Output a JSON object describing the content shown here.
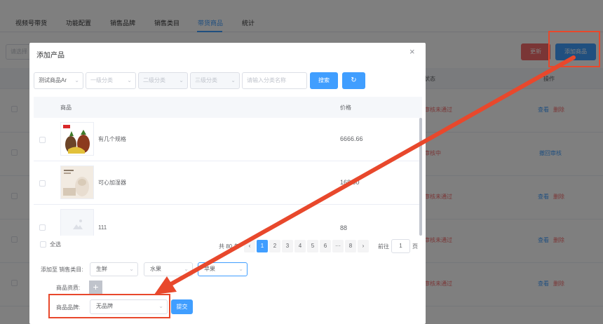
{
  "tabs": [
    "视频号带货",
    "功能配置",
    "销售品牌",
    "销售类目",
    "带货商品",
    "统计"
  ],
  "active_tab": "带货商品",
  "background": {
    "select_placeholder": "请选择",
    "refresh_label": "更新",
    "add_label": "添加商品",
    "col_status": "状态",
    "col_actions": "操作",
    "rows": [
      {
        "status": "审核未通过",
        "actions": [
          "查看",
          "删除"
        ]
      },
      {
        "status": "审核中",
        "actions": [
          "撤回审核"
        ]
      },
      {
        "status": "审核未通过",
        "actions": [
          "查看",
          "删除"
        ]
      },
      {
        "status": "审核未通过",
        "actions": [
          "查看",
          "删除"
        ]
      },
      {
        "status": "审核未通过",
        "actions": [
          "查看",
          "删除"
        ]
      }
    ]
  },
  "dialog": {
    "title": "添加产品",
    "close": "×",
    "filters": {
      "store": "测试商品Ar",
      "level1": "一级分类",
      "level2": "二级分类",
      "level3": "三级分类",
      "search_placeholder": "请输入分类名称",
      "search_label": "搜索",
      "refresh_icon": "↻"
    },
    "table": {
      "col_product": "商品",
      "col_price": "价格",
      "rows": [
        {
          "name": "有几个规格",
          "price": "6666.66"
        },
        {
          "name": "可心加湿器",
          "price": "168.00"
        },
        {
          "name": "111",
          "price": "88"
        }
      ]
    },
    "select_all": "全选",
    "pagination": {
      "total": "共 80 条",
      "pages": [
        "1",
        "2",
        "3",
        "4",
        "5",
        "6",
        "···",
        "8"
      ],
      "current": "1",
      "prev": "‹",
      "next": "›",
      "goto_label": "前往",
      "goto_value": "1",
      "unit": "页"
    },
    "form": {
      "add_to_label": "添加至 销售类目:",
      "cat1": "生鲜",
      "cat2": "水果",
      "cat3": "苹果",
      "qualification_label": "商品资质:",
      "upload_icon": "+",
      "brand_label": "商品品牌:",
      "brand_value": "无品牌",
      "submit_label": "提交"
    }
  },
  "annotation": {
    "color": "#e8482c"
  }
}
